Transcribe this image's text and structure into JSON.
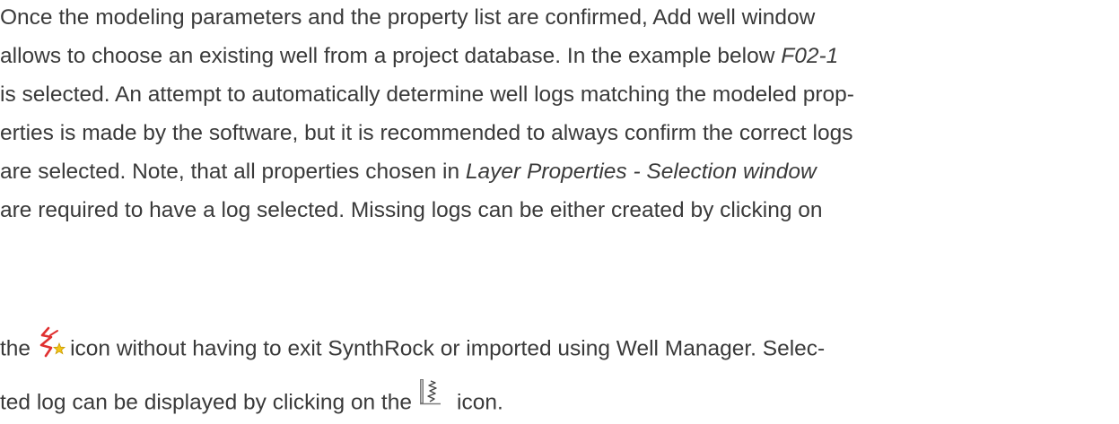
{
  "paragraph": {
    "line1": {
      "text": "Once the modeling parameters and the property list are confirmed, Add well window"
    },
    "line2": {
      "text": "allows to choose an existing well from a project database. In the example below "
    },
    "line2_italic": "F02-1",
    "line3": {
      "text": "is selected. An attempt to automatically determine well logs matching the modeled prop-"
    },
    "line4": {
      "text": "erties is made by the software, but it is recommended to always confirm the correct logs"
    },
    "line5": {
      "pre": "are selected. Note, that all properties chosen in ",
      "italic": "Layer Properties - Selection window"
    },
    "line6": {
      "text": "are required to have a log selected. Missing logs can be either created by clicking on"
    },
    "line7": {
      "pre": "the",
      "post": "icon without having to exit SynthRock or imported using Well Manager. Selec-"
    },
    "line8": {
      "pre": "ted log can be displayed by clicking on the",
      "post": "icon."
    }
  },
  "icons": {
    "create_log": "create-log-icon",
    "display_log": "display-log-icon"
  },
  "colors": {
    "text": "#3a3a3a",
    "icon_red": "#e03030",
    "icon_yellow": "#f2c418"
  }
}
